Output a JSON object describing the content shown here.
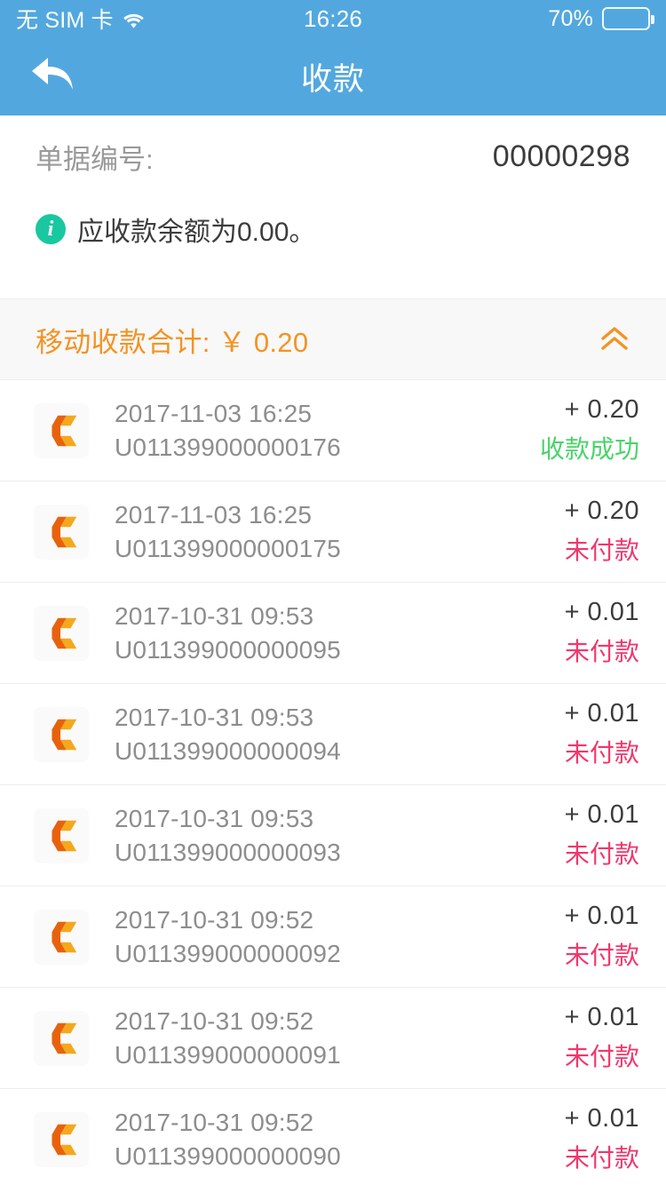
{
  "status_bar": {
    "carrier": "无 SIM 卡",
    "wifi_icon": "wifi-icon",
    "time": "16:26",
    "battery_percent": "70%",
    "battery_level": 70
  },
  "nav": {
    "back_icon": "back-arrow-icon",
    "title": "收款"
  },
  "doc": {
    "label": "单据编号:",
    "value": "00000298",
    "notice_icon": "info-icon",
    "notice_text": "应收款余额为0.00。"
  },
  "summary": {
    "text": "移动收款合计: ￥ 0.20",
    "collapse_icon": "double-chevron-up-icon",
    "accent_color": "#F39324"
  },
  "colors": {
    "header_blue": "#52A8DE",
    "success_green": "#48D468",
    "unpaid_red": "#F2366B",
    "info_teal": "#19C8A0",
    "logo_orange": "#E8620C",
    "logo_amber": "#F5A81C"
  },
  "transactions": [
    {
      "logo": "company-c-logo",
      "time": "2017-11-03 16:25",
      "order_no": "U011399000000176",
      "amount": "+ 0.20",
      "status": "收款成功",
      "status_kind": "success"
    },
    {
      "logo": "company-c-logo",
      "time": "2017-11-03 16:25",
      "order_no": "U011399000000175",
      "amount": "+ 0.20",
      "status": "未付款",
      "status_kind": "unpaid"
    },
    {
      "logo": "company-c-logo",
      "time": "2017-10-31 09:53",
      "order_no": "U011399000000095",
      "amount": "+ 0.01",
      "status": "未付款",
      "status_kind": "unpaid"
    },
    {
      "logo": "company-c-logo",
      "time": "2017-10-31 09:53",
      "order_no": "U011399000000094",
      "amount": "+ 0.01",
      "status": "未付款",
      "status_kind": "unpaid"
    },
    {
      "logo": "company-c-logo",
      "time": "2017-10-31 09:53",
      "order_no": "U011399000000093",
      "amount": "+ 0.01",
      "status": "未付款",
      "status_kind": "unpaid"
    },
    {
      "logo": "company-c-logo",
      "time": "2017-10-31 09:52",
      "order_no": "U011399000000092",
      "amount": "+ 0.01",
      "status": "未付款",
      "status_kind": "unpaid"
    },
    {
      "logo": "company-c-logo",
      "time": "2017-10-31 09:52",
      "order_no": "U011399000000091",
      "amount": "+ 0.01",
      "status": "未付款",
      "status_kind": "unpaid"
    },
    {
      "logo": "company-c-logo",
      "time": "2017-10-31 09:52",
      "order_no": "U011399000000090",
      "amount": "+ 0.01",
      "status": "未付款",
      "status_kind": "unpaid"
    }
  ]
}
